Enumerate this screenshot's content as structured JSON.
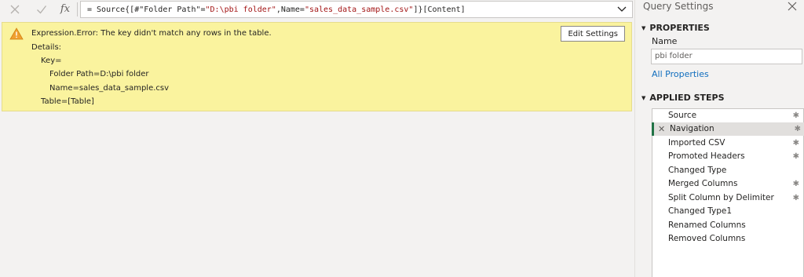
{
  "formula_bar": {
    "cancel_icon": "close-icon",
    "commit_icon": "check-icon",
    "fx_label": "fx",
    "formula_prefix": "= Source{[#\"Folder Path\"=",
    "formula_str1": "\"D:\\pbi folder\"",
    "formula_mid": ",Name=",
    "formula_str2": "\"sales_data_sample.csv\"",
    "formula_suffix": "]}[Content]",
    "expand_icon": "chevron-down-icon"
  },
  "error": {
    "icon": "warning-icon",
    "message": "Expression.Error: The key didn't match any rows in the table.",
    "details_label": "Details:",
    "key_label": "Key=",
    "folder_path": "Folder Path=D:\\pbi folder",
    "name": "Name=sales_data_sample.csv",
    "table": "Table=[Table]",
    "edit_settings_label": "Edit Settings"
  },
  "query_settings": {
    "title": "Query Settings",
    "close_icon": "close-icon",
    "properties_header": "PROPERTIES",
    "name_label": "Name",
    "name_value": "pbi folder",
    "all_properties_link": "All Properties",
    "applied_steps_header": "APPLIED STEPS",
    "steps": [
      {
        "label": "Source",
        "gear": true
      },
      {
        "label": "Navigation",
        "gear": true,
        "selected": true
      },
      {
        "label": "Imported CSV",
        "gear": true
      },
      {
        "label": "Promoted Headers",
        "gear": true
      },
      {
        "label": "Changed Type",
        "gear": false
      },
      {
        "label": "Merged Columns",
        "gear": true
      },
      {
        "label": "Split Column by Delimiter",
        "gear": true
      },
      {
        "label": "Changed Type1",
        "gear": false
      },
      {
        "label": "Renamed Columns",
        "gear": false
      },
      {
        "label": "Removed Columns",
        "gear": false
      }
    ]
  },
  "colors": {
    "error_background": "#faf39e",
    "selected_step_accent": "#217346",
    "link": "#106ebe",
    "string_literal": "#a31515"
  }
}
